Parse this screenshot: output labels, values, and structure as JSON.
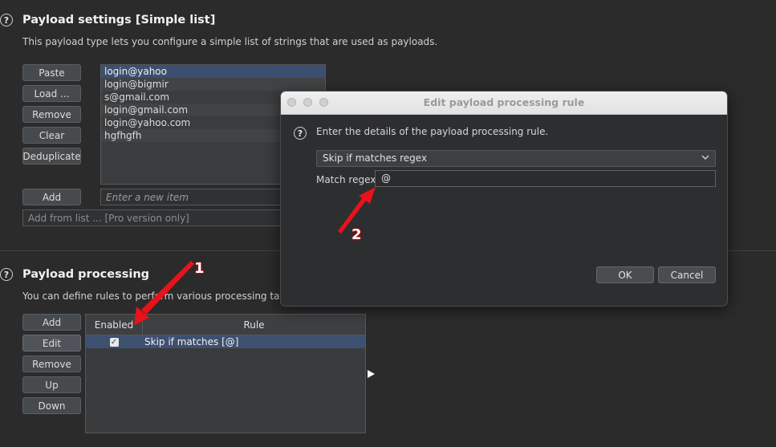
{
  "payload_settings": {
    "title": "Payload settings [Simple list]",
    "description": "This payload type lets you configure a simple list of strings that are used as payloads.",
    "buttons": [
      "Paste",
      "Load ...",
      "Remove",
      "Clear",
      "Deduplicate"
    ],
    "items": [
      "login@yahoo",
      "login@bigmir",
      "s@gmail.com",
      "login@gmail.com",
      "login@yahoo.com",
      "hgfhgfh"
    ],
    "selected_item": "login@yahoo",
    "add_label": "Add",
    "new_item_placeholder": "Enter a new item",
    "add_from_list": "Add from list ... [Pro version only]"
  },
  "payload_processing": {
    "title": "Payload processing",
    "description": "You can define rules to perform various processing tasks on",
    "buttons": [
      "Add",
      "Edit",
      "Remove",
      "Up",
      "Down"
    ],
    "active_button": "Edit",
    "columns": [
      "Enabled",
      "Rule"
    ],
    "rules": [
      {
        "enabled": true,
        "rule": "Skip if matches [@]"
      }
    ]
  },
  "dialog": {
    "title": "Edit payload processing rule",
    "instruction": "Enter the details of the payload processing rule.",
    "rule_type": "Skip if matches regex",
    "regex_label": "Match regex:",
    "regex_value": "@",
    "ok_label": "OK",
    "cancel_label": "Cancel"
  },
  "annotations": {
    "arrow1_label": "1",
    "arrow2_label": "2",
    "color": "#e8121b"
  },
  "icons": {
    "help": "?",
    "check": "✓",
    "chevron": "chevron-down-icon"
  }
}
